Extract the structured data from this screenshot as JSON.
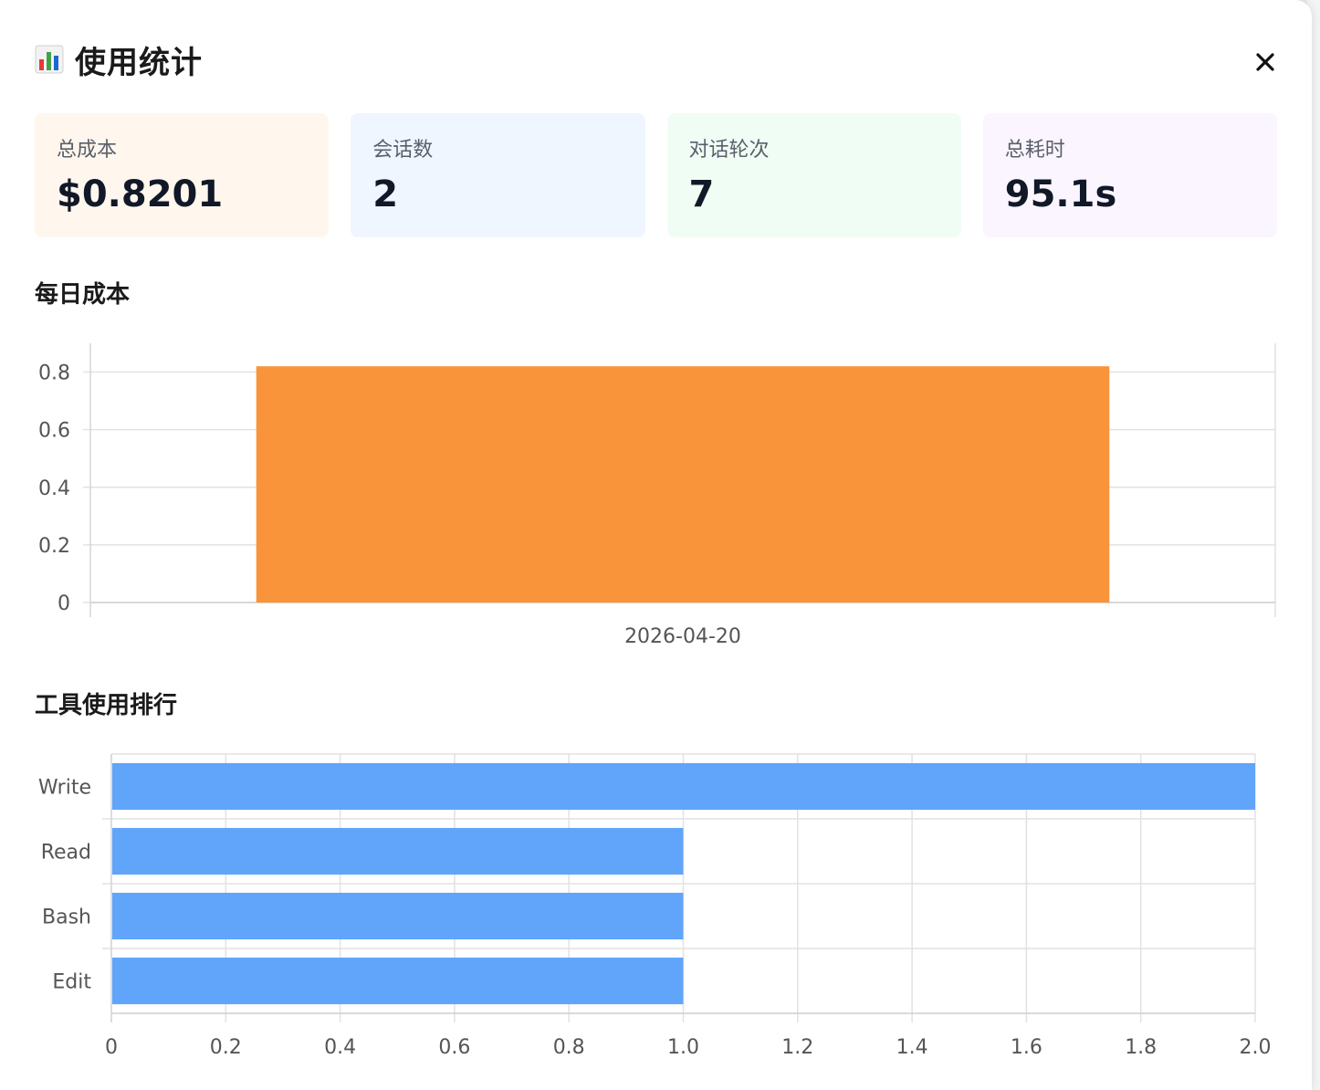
{
  "modal": {
    "title": "使用统计",
    "icon": "bar-chart-icon",
    "close_icon": "close-icon"
  },
  "cards": [
    {
      "label": "总成本",
      "value": "$0.8201",
      "bg": "#fff7ed"
    },
    {
      "label": "会话数",
      "value": "2",
      "bg": "#eff6ff"
    },
    {
      "label": "对话轮次",
      "value": "7",
      "bg": "#f0fdf4"
    },
    {
      "label": "总耗时",
      "value": "95.1s",
      "bg": "#faf5ff"
    }
  ],
  "sections": {
    "daily_cost": "每日成本",
    "tool_ranking": "工具使用排行"
  },
  "chart_data": [
    {
      "type": "bar",
      "title": "每日成本",
      "categories": [
        "2026-04-20"
      ],
      "values": [
        0.8201
      ],
      "ylim": [
        0,
        0.9
      ],
      "yticks": [
        "0",
        "0.2",
        "0.4",
        "0.6",
        "0.8"
      ],
      "color": "#f9943b",
      "grid": true
    },
    {
      "type": "bar",
      "orientation": "horizontal",
      "title": "工具使用排行",
      "categories": [
        "Write",
        "Read",
        "Bash",
        "Edit"
      ],
      "values": [
        2,
        1,
        1,
        1
      ],
      "xlim": [
        0,
        2
      ],
      "xticks": [
        "0",
        "0.2",
        "0.4",
        "0.6",
        "0.8",
        "1.0",
        "1.2",
        "1.4",
        "1.6",
        "1.8",
        "2.0"
      ],
      "color": "#60a5fa",
      "grid": true
    }
  ]
}
